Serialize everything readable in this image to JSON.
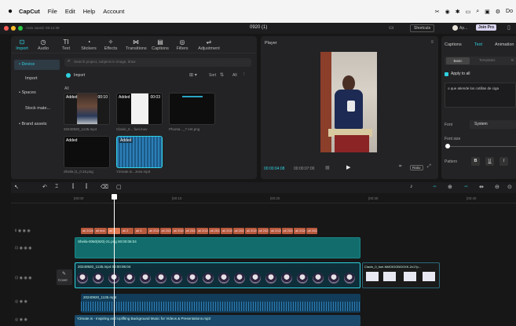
{
  "menubar": {
    "apple_icon": "apple-icon",
    "app_name": "CapCut",
    "items": [
      "File",
      "Edit",
      "Help",
      "Account"
    ],
    "right_icons": [
      "capcut-tray-icon",
      "record-icon",
      "bluetooth-icon",
      "battery-icon",
      "search-icon",
      "screen-icon",
      "settings-icon"
    ],
    "right_text": "Do"
  },
  "titlebar": {
    "autosave_text": "Auto saved: 09:14:39",
    "project_name": "0920 (1)",
    "shortcuts_label": "Shortcuts",
    "user_label": "Ap...",
    "join_pro_label": "Join Pro"
  },
  "media_toolbar": {
    "tabs": [
      {
        "label": "Import",
        "icon": "import-icon"
      },
      {
        "label": "Audio",
        "icon": "audio-icon"
      },
      {
        "label": "Text",
        "icon": "text-icon"
      },
      {
        "label": "Stickers",
        "icon": "stickers-icon"
      },
      {
        "label": "Effects",
        "icon": "effects-icon"
      },
      {
        "label": "Transitions",
        "icon": "transitions-icon"
      },
      {
        "label": "Captions",
        "icon": "captions-icon"
      },
      {
        "label": "Filters",
        "icon": "filters-icon"
      },
      {
        "label": "Adjustment",
        "icon": "adjustment-icon"
      }
    ]
  },
  "media_sidebar": {
    "items": [
      "• Device",
      "Import",
      "• Spaces",
      "Stock mate...",
      "• Brand assets"
    ]
  },
  "media_panel": {
    "search_placeholder": "Search project, subjects in image, draw",
    "import_label": "Import",
    "sort_label": "Sort",
    "all_label": "All",
    "thumbnails": [
      {
        "badge": "Added",
        "duration": "00:10",
        "name": "20240920_1135.mp4"
      },
      {
        "badge": "Added",
        "duration": "00:03",
        "name": "Clavin_0... fuel.mov"
      },
      {
        "badge": "",
        "duration": "",
        "name": "Phonta..._7 ent.png"
      },
      {
        "badge": "Added",
        "duration": "",
        "name": "Sheila (1_0:15.png"
      },
      {
        "badge": "Added",
        "duration": "",
        "name": "Y2mate.is...Jose.mp3"
      }
    ]
  },
  "player": {
    "title": "Player",
    "current_time": "00:00:04:08",
    "total_time": "00:00:07:00",
    "ratio_label": "Ratio"
  },
  "right_panel": {
    "tabs": [
      "Captions",
      "Text",
      "Animation"
    ],
    "subtabs": [
      "Basic",
      "Templates",
      "B"
    ],
    "apply_all_label": "Apply to all",
    "text_value": "o que atiende los cotillas de ciga",
    "font_label": "Font",
    "font_value": "System",
    "font_size_label": "Font size",
    "pattern_label": "Pattern",
    "pattern_buttons": [
      "B",
      "U",
      "I"
    ]
  },
  "timeline": {
    "ticks": [
      "|00:00",
      "|00:10",
      "|00:20",
      "|00:30",
      "|00:40",
      "|00:50"
    ],
    "caption_chips": [
      "all 2024",
      "all text",
      "all 1",
      "all 2",
      "all 3",
      "all 2024",
      "all 2024",
      "all 2024",
      "all 2024",
      "all 2024",
      "all 2024",
      "all 2024",
      "all 2024",
      "all 2024",
      "all 2024",
      "all 2024",
      "all 2024",
      "all 2024",
      "all 2024"
    ],
    "overlay_clip_label": "Sheila-0060(920)-21.png  00:00:06:04",
    "main_clip_label": "20240920_1135.mp4  00:00:06:04",
    "secondary_clip_label": "Clavin_0_fuel-NMOIOOBGOXK-2x17p...",
    "cover_label": "Cover",
    "audio_label_1": "20240920_1135.mp4",
    "audio_label_2": "Y2mate.is - Inspiring and Uplifting Background Music for Videos & Presentations.mp3"
  },
  "colors": {
    "accent": "#1fb6c4",
    "caption_clip": "#b85a3c",
    "overlay_clip": "#136c6c",
    "audio_clip": "#1a4a6b",
    "selected": "#2f7de1"
  }
}
